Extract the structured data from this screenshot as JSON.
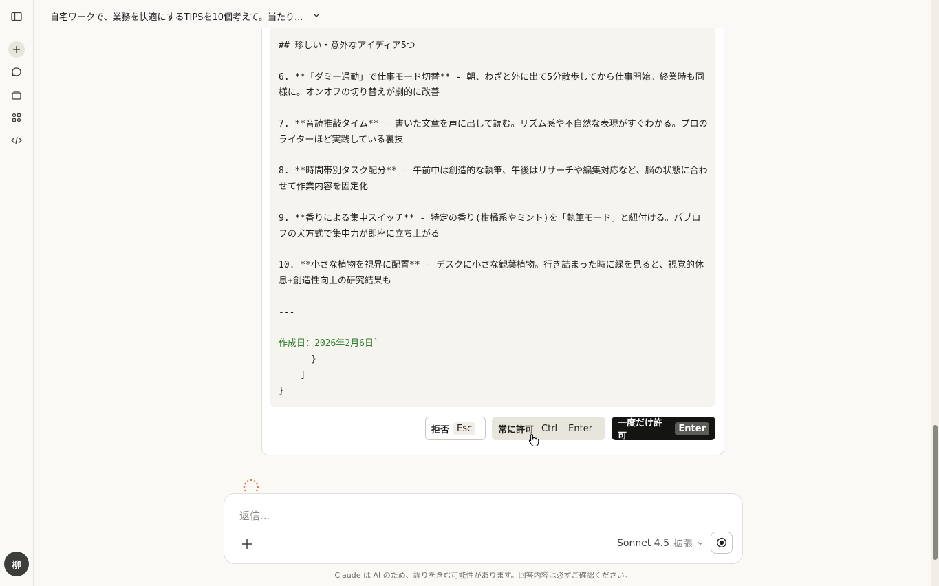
{
  "header": {
    "title": "自宅ワークで、業務を快適にするTIPSを10個考えて。当たり..."
  },
  "sidebar": {
    "avatar_initial": "柳"
  },
  "code_lines": [
    {
      "text": "## 珍しい・意外なアイディア5つ",
      "green": false
    },
    {
      "text": "",
      "green": false
    },
    {
      "text": "6. **「ダミー通勤」で仕事モード切替** - 朝、わざと外に出て5分散歩してから仕事開始。終業時も同様に。オンオフの切り替えが劇的に改善",
      "green": false
    },
    {
      "text": "",
      "green": false
    },
    {
      "text": "7. **音読推敲タイム** - 書いた文章を声に出して読む。リズム感や不自然な表現がすぐわかる。プロのライターほど実践している裏技",
      "green": false
    },
    {
      "text": "",
      "green": false
    },
    {
      "text": "8. **時間帯別タスク配分** - 午前中は創造的な執筆、午後はリサーチや編集対応など、脳の状態に合わせて作業内容を固定化",
      "green": false
    },
    {
      "text": "",
      "green": false
    },
    {
      "text": "9. **香りによる集中スイッチ** - 特定の香り(柑橘系やミント)を「執筆モード」と紐付ける。パブロフの犬方式で集中力が即座に立ち上がる",
      "green": false
    },
    {
      "text": "",
      "green": false
    },
    {
      "text": "10. **小さな植物を視界に配置** - デスクに小さな観葉植物。行き詰まった時に緑を見ると、視覚的休息+創造性向上の研究結果も",
      "green": false
    },
    {
      "text": "",
      "green": false
    },
    {
      "text": "---",
      "green": false
    },
    {
      "text": "",
      "green": false
    },
    {
      "text": "作成日：2026年2月6日`",
      "green": true
    },
    {
      "text": "      }",
      "green": false
    },
    {
      "text": "    ]",
      "green": false
    },
    {
      "text": "}",
      "green": false
    }
  ],
  "permission": {
    "reject_label": "拒否",
    "reject_key": "Esc",
    "always_label": "常に許可",
    "always_key1": "Ctrl",
    "always_key2": "Enter",
    "once_label": "一度だけ許可",
    "once_key": "Enter"
  },
  "composer": {
    "placeholder": "返信...",
    "model": "Sonnet 4.5",
    "extended": "拡張"
  },
  "footer": {
    "disclaimer": "Claude は AI のため、誤りを含む可能性があります。回答内容は必ずご確認ください。"
  },
  "colors": {
    "accent": "#d97757",
    "code_green": "#2b7a2b",
    "primary_button": "#141413"
  }
}
